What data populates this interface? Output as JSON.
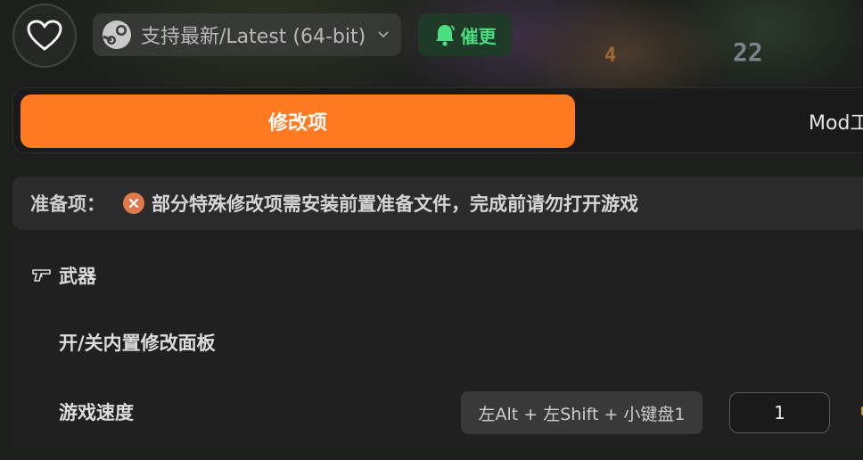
{
  "background": {
    "glyph_4": "4",
    "glyph_22": "22"
  },
  "header": {
    "favorite_icon": "heart-icon",
    "platform": {
      "icon": "steam-icon",
      "label": "支持最新/Latest (64-bit)",
      "chevron": "chevron-down-icon"
    },
    "remind": {
      "icon": "bell-icon",
      "label": "催更",
      "color": "#4ade80"
    }
  },
  "tabs": [
    {
      "label": "修改项",
      "active": true
    },
    {
      "label": "Mod工"
    }
  ],
  "prep": {
    "label": "准备项：",
    "icon": "close-circle-icon",
    "message": "部分特殊修改项需安装前置准备文件，完成前请勿打开游戏"
  },
  "section": {
    "icon": "gun-icon",
    "title": "武器",
    "rows": [
      {
        "label": "开/关内置修改面板"
      },
      {
        "label": "游戏速度",
        "hotkey": "左Alt + 左Shift + 小键盘1",
        "value": "1"
      }
    ]
  },
  "colors": {
    "accent": "#ff7a21",
    "panel": "#202020"
  }
}
